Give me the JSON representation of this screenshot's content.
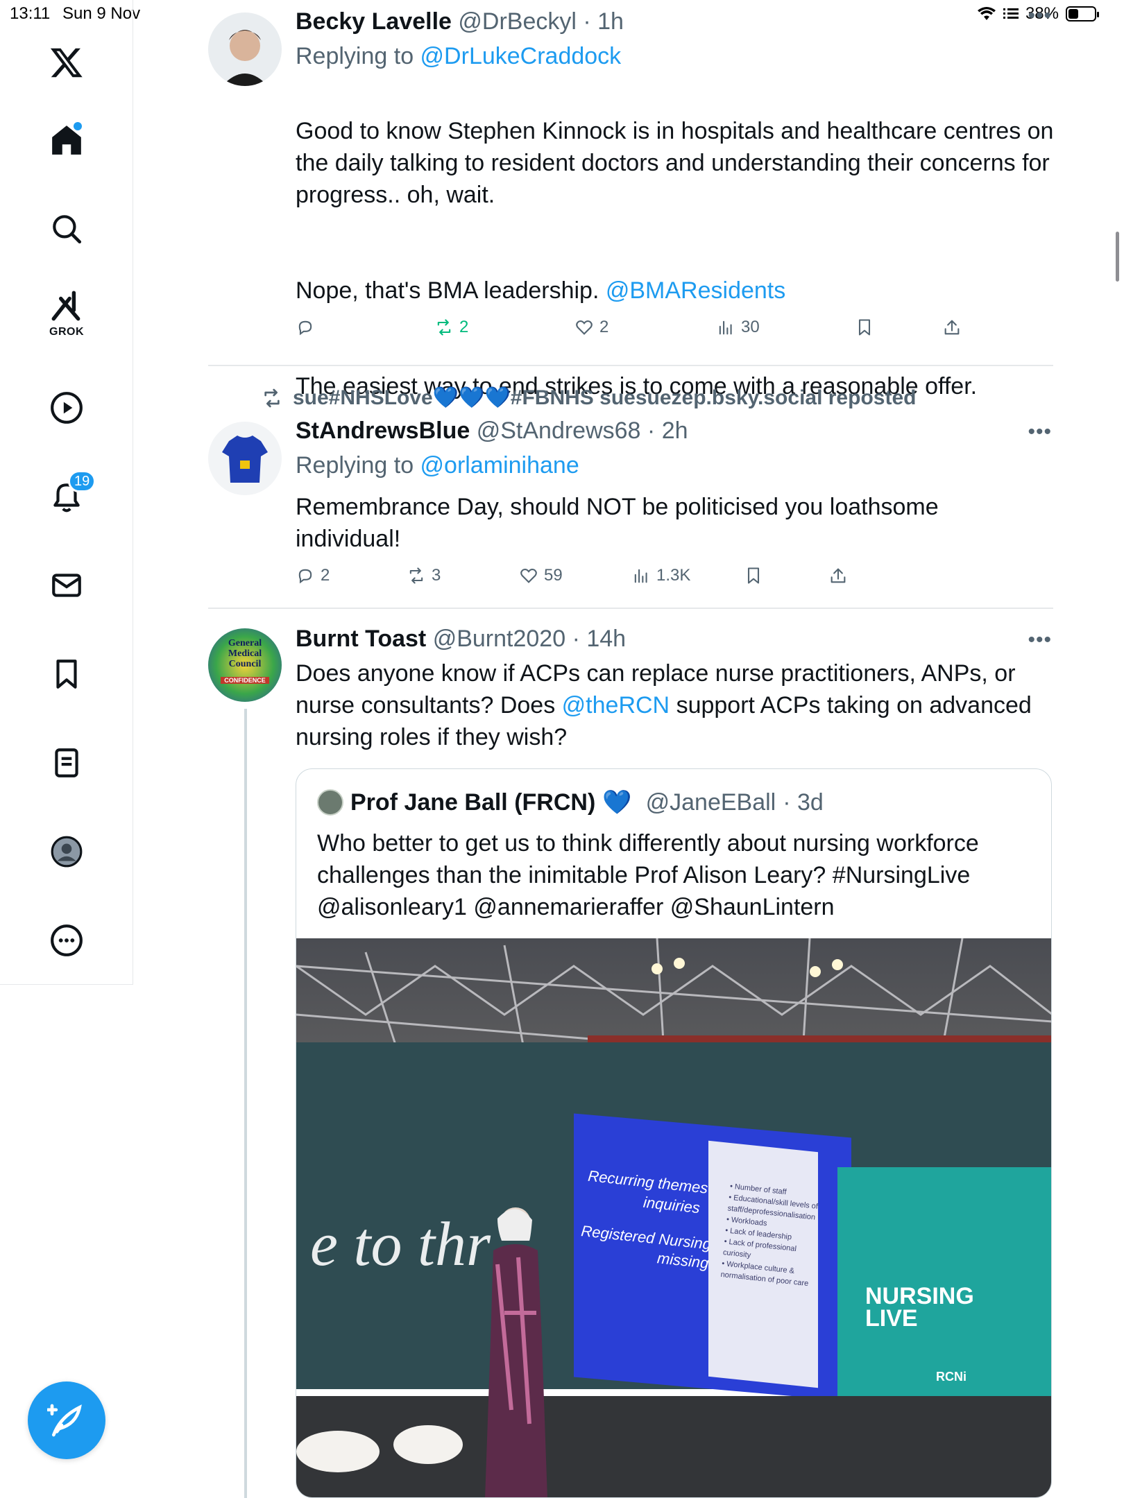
{
  "status_bar": {
    "time": "13:11",
    "date": "Sun 9 Nov",
    "battery": "38%",
    "battery_level": 0.38
  },
  "sidebar": {
    "grok_label": "GROK",
    "notifications_count": "19"
  },
  "tweets": [
    {
      "name": "Becky Lavelle",
      "handle": "@DrBeckyl",
      "time": "· 1h",
      "replying_prefix": "Replying to ",
      "replying_to": "@DrLukeCraddock",
      "text_1": "Good to know Stephen Kinnock is in hospitals and healthcare centres on the daily talking to resident doctors and understanding their concerns for progress.. oh, wait.",
      "text_2": "Nope, that's BMA leadership. ",
      "text_2_link": "@BMAResidents",
      "text_3": "The easiest way to end strikes is to come with a reasonable offer.",
      "replies": "",
      "reposts": "2",
      "likes": "2",
      "views": "30"
    },
    {
      "repost_label": "sue#NHSLove💙💙💙#FBNHS suesuezep.bsky.social reposted",
      "name": "StAndrewsBlue",
      "handle": "@StAndrews68",
      "time": "· 2h",
      "replying_prefix": "Replying to ",
      "replying_to": "@orlaminihane",
      "text": "Remembrance Day, should NOT be politicised you loathsome individual!",
      "replies": "2",
      "reposts": "3",
      "likes": "59",
      "views": "1.3K"
    },
    {
      "name": "Burnt Toast",
      "handle": "@Burnt2020",
      "time": "· 14h",
      "avatar_text_1": "General",
      "avatar_text_2": "Medical",
      "avatar_text_3": "Council",
      "avatar_text_4": "CONFIDENCE",
      "text_1": "Does anyone know if ACPs can replace nurse practitioners, ANPs, or nurse consultants? Does ",
      "text_link": "@theRCN",
      "text_2": " support ACPs taking on advanced nursing roles if they wish?",
      "quote": {
        "name": "Prof Jane Ball (FRCN)",
        "badge": "💙",
        "handle": "@JaneEBall",
        "time": "· 3d",
        "text": "Who better to get us to think differently about nursing workforce challenges than the inimitable Prof Alison Leary? #NursingLive @alisonleary1 @annemarieraffer @ShaunLintern",
        "image": {
          "screen_line_1": "Recurring themes in",
          "screen_line_2": "inquiries",
          "screen_line_3": "Registered Nursing is",
          "screen_line_4": "missing",
          "list": "• Number of staff\n• Educational/skill levels of\n  staff/deprofessionalisation\n• Workloads\n• Lack of leadership\n• Lack of professional\n  curiosity\n• Workplace culture &\n  normalisation of poor care",
          "brand": "NURSING\nLIVE",
          "rcni": "RCNi",
          "wall_text": "e to thr"
        }
      }
    }
  ],
  "colors": {
    "accent": "#1d9bf0",
    "text": "#0f1419",
    "muted": "#536471",
    "repost_active": "#00ba7c",
    "border": "#e6e8ea"
  }
}
